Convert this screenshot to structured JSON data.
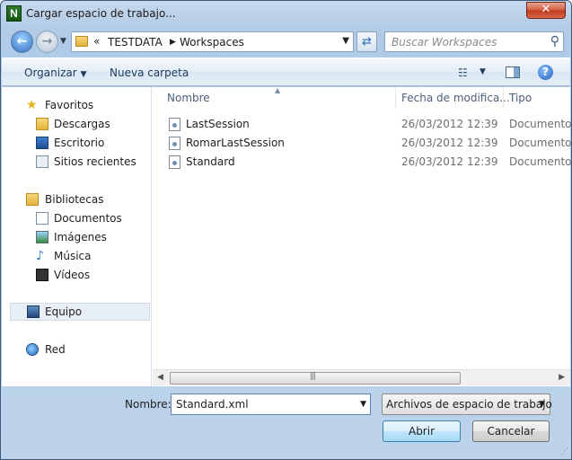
{
  "window": {
    "title": "Cargar espacio de trabajo...",
    "app_icon_letter": "N",
    "close_glyph": "✕"
  },
  "address": {
    "overflow_chevron": "«",
    "crumbs": [
      "TESTDATA",
      "Workspaces"
    ],
    "search_placeholder": "Buscar Workspaces"
  },
  "toolbar": {
    "organize_label": "Organizar",
    "new_folder_label": "Nueva carpeta"
  },
  "nav": {
    "favorites": "Favoritos",
    "downloads": "Descargas",
    "desktop": "Escritorio",
    "recent": "Sitios recientes",
    "libraries": "Bibliotecas",
    "documents": "Documentos",
    "pictures": "Imágenes",
    "music": "Música",
    "videos": "Vídeos",
    "computer": "Equipo",
    "network": "Red"
  },
  "columns": {
    "name": "Nombre",
    "modified": "Fecha de modifica...",
    "type": "Tipo"
  },
  "files": [
    {
      "name": "LastSession",
      "modified": "26/03/2012 12:39",
      "type": "Documento"
    },
    {
      "name": "RomarLastSession",
      "modified": "26/03/2012 12:39",
      "type": "Documento"
    },
    {
      "name": "Standard",
      "modified": "26/03/2012 12:39",
      "type": "Documento"
    }
  ],
  "footer": {
    "filename_label": "Nombre:",
    "filename_value": "Standard.xml",
    "filter_value": "Archivos de espacio de trabajo",
    "open_label": "Abrir",
    "cancel_label": "Cancelar"
  },
  "colors": {
    "accent": "#3c7fb1",
    "title_bar": "#c7d9ee",
    "close_button": "#c23a1d"
  },
  "icons": [
    "back-arrow-icon",
    "forward-arrow-icon",
    "folder-icon",
    "refresh-icon",
    "search-icon",
    "views-icon",
    "preview-pane-icon",
    "help-icon",
    "star-icon",
    "downloads-folder-icon",
    "desktop-icon",
    "recent-places-icon",
    "library-icon",
    "documents-icon",
    "pictures-icon",
    "music-icon",
    "videos-icon",
    "computer-icon",
    "network-icon",
    "document-file-icon"
  ]
}
